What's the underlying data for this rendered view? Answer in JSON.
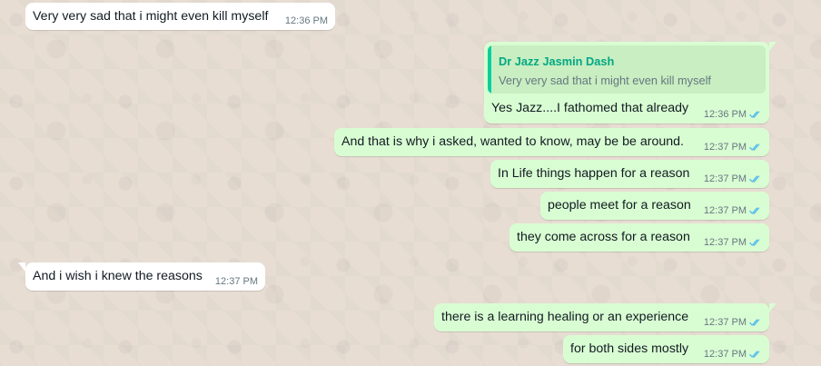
{
  "chat": {
    "messages": [
      {
        "direction": "incoming",
        "text": "Very very sad that i might even kill myself",
        "time": "12:36 PM"
      },
      {
        "direction": "outgoing",
        "quote": {
          "author": "Dr Jazz Jasmin Dash",
          "text": "Very very sad that i might even kill myself"
        },
        "text": "Yes Jazz....I fathomed that already",
        "time": "12:36 PM",
        "status_icon": "double-check-read-icon"
      },
      {
        "direction": "outgoing",
        "text": "And that is why i asked, wanted to know, may be be around.",
        "time": "12:37 PM",
        "status_icon": "double-check-read-icon"
      },
      {
        "direction": "outgoing",
        "text": "In Life things happen for a reason",
        "time": "12:37 PM",
        "status_icon": "double-check-read-icon"
      },
      {
        "direction": "outgoing",
        "text": "people meet for a reason",
        "time": "12:37 PM",
        "status_icon": "double-check-read-icon"
      },
      {
        "direction": "outgoing",
        "text": "they come across for a reason",
        "time": "12:37 PM",
        "status_icon": "double-check-read-icon"
      },
      {
        "direction": "incoming",
        "text": "And i wish i knew the reasons",
        "time": "12:37 PM"
      },
      {
        "direction": "outgoing",
        "text": "there is a learning healing or an experience",
        "time": "12:37 PM",
        "status_icon": "double-check-read-icon"
      },
      {
        "direction": "outgoing",
        "text": "for both sides mostly",
        "time": "12:37 PM",
        "status_icon": "double-check-read-icon"
      }
    ]
  },
  "colors": {
    "wallpaper": "#e7ddd3",
    "incoming_bubble": "#ffffff",
    "outgoing_bubble": "#d9fdd3",
    "quote_accent": "#06cf9c",
    "read_ticks": "#53bdeb"
  }
}
